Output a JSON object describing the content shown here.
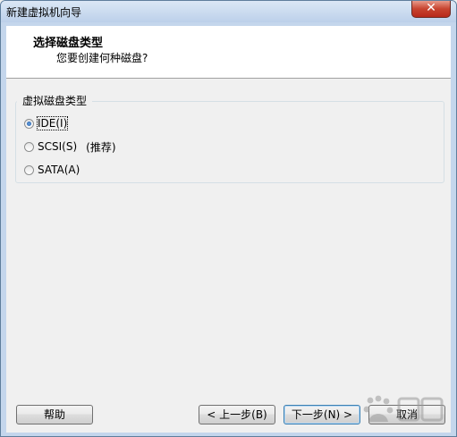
{
  "window": {
    "title": "新建虚拟机向导",
    "close_glyph": "✕"
  },
  "header": {
    "title": "选择磁盘类型",
    "subtitle": "您要创建何种磁盘?"
  },
  "disk_type_group": {
    "legend": "虚拟磁盘类型",
    "options": [
      {
        "label": "IDE(I)",
        "checked": true
      },
      {
        "label": "SCSI(S)",
        "note": "(推荐)",
        "checked": false
      },
      {
        "label": "SATA(A)",
        "checked": false
      }
    ]
  },
  "buttons": {
    "help": "帮助",
    "back": "< 上一步(B)",
    "next": "下一步(N) >",
    "cancel": "取消"
  }
}
